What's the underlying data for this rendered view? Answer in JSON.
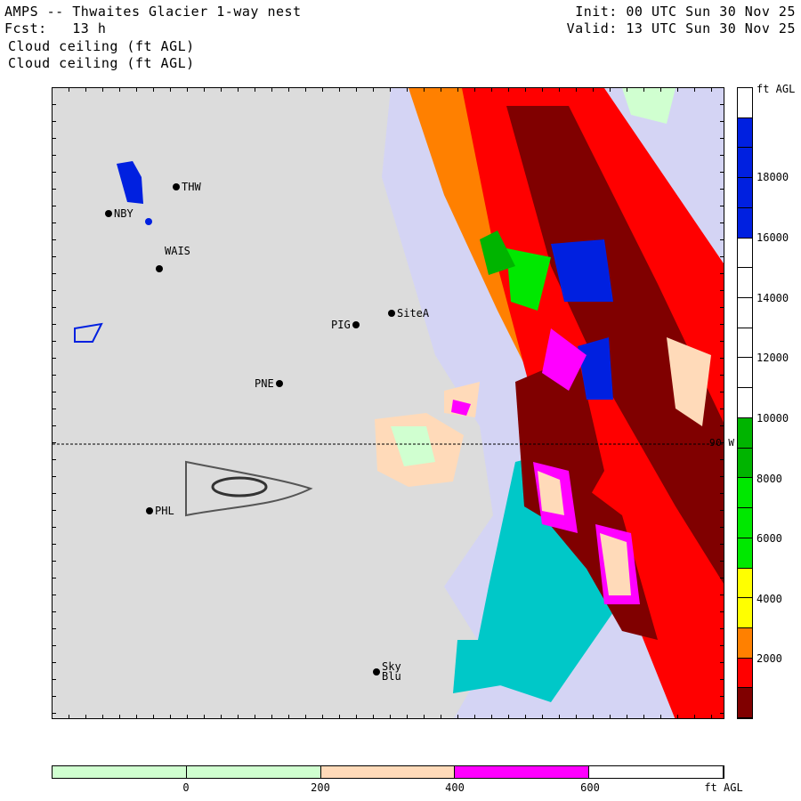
{
  "header": {
    "title": "AMPS -- Thwaites Glacier 1-way nest",
    "forecast": "Fcst:   13 h",
    "field_1": "Cloud ceiling (ft AGL)",
    "field_2": "Cloud ceiling (ft AGL)",
    "init": "Init: 00 UTC Sun 30 Nov 25",
    "valid": "Valid: 13 UTC Sun 30 Nov 25"
  },
  "map": {
    "meridian_label": "90 W",
    "stations": [
      "THW",
      "NBY",
      "WAIS",
      "SiteA",
      "PIG",
      "PNE",
      "PHL",
      "Sky",
      "Blu"
    ]
  },
  "colorbar": {
    "units": "ft AGL",
    "labels": [
      "18000",
      "16000",
      "14000",
      "12000",
      "10000",
      "8000",
      "6000",
      "4000",
      "2000"
    ],
    "colors": [
      "#ffffff",
      "#0020e0",
      "#0020e0",
      "#0020e0",
      "#0020e0",
      "#ffffff",
      "#ffffff",
      "#ffffff",
      "#ffffff",
      "#ffffff",
      "#ffffff",
      "#00b400",
      "#00b400",
      "#00e800",
      "#00e800",
      "#00e800",
      "#ffff00",
      "#ffff00",
      "#ff8000",
      "#ff0000",
      "#800000"
    ]
  },
  "bottom_bar": {
    "units": "ft AGL",
    "labels": [
      "0",
      "200",
      "400",
      "600"
    ],
    "colors": [
      "#d0ffd0",
      "#d0ffd0",
      "#ffdab9",
      "#ff00ff",
      "#ffffff"
    ]
  }
}
